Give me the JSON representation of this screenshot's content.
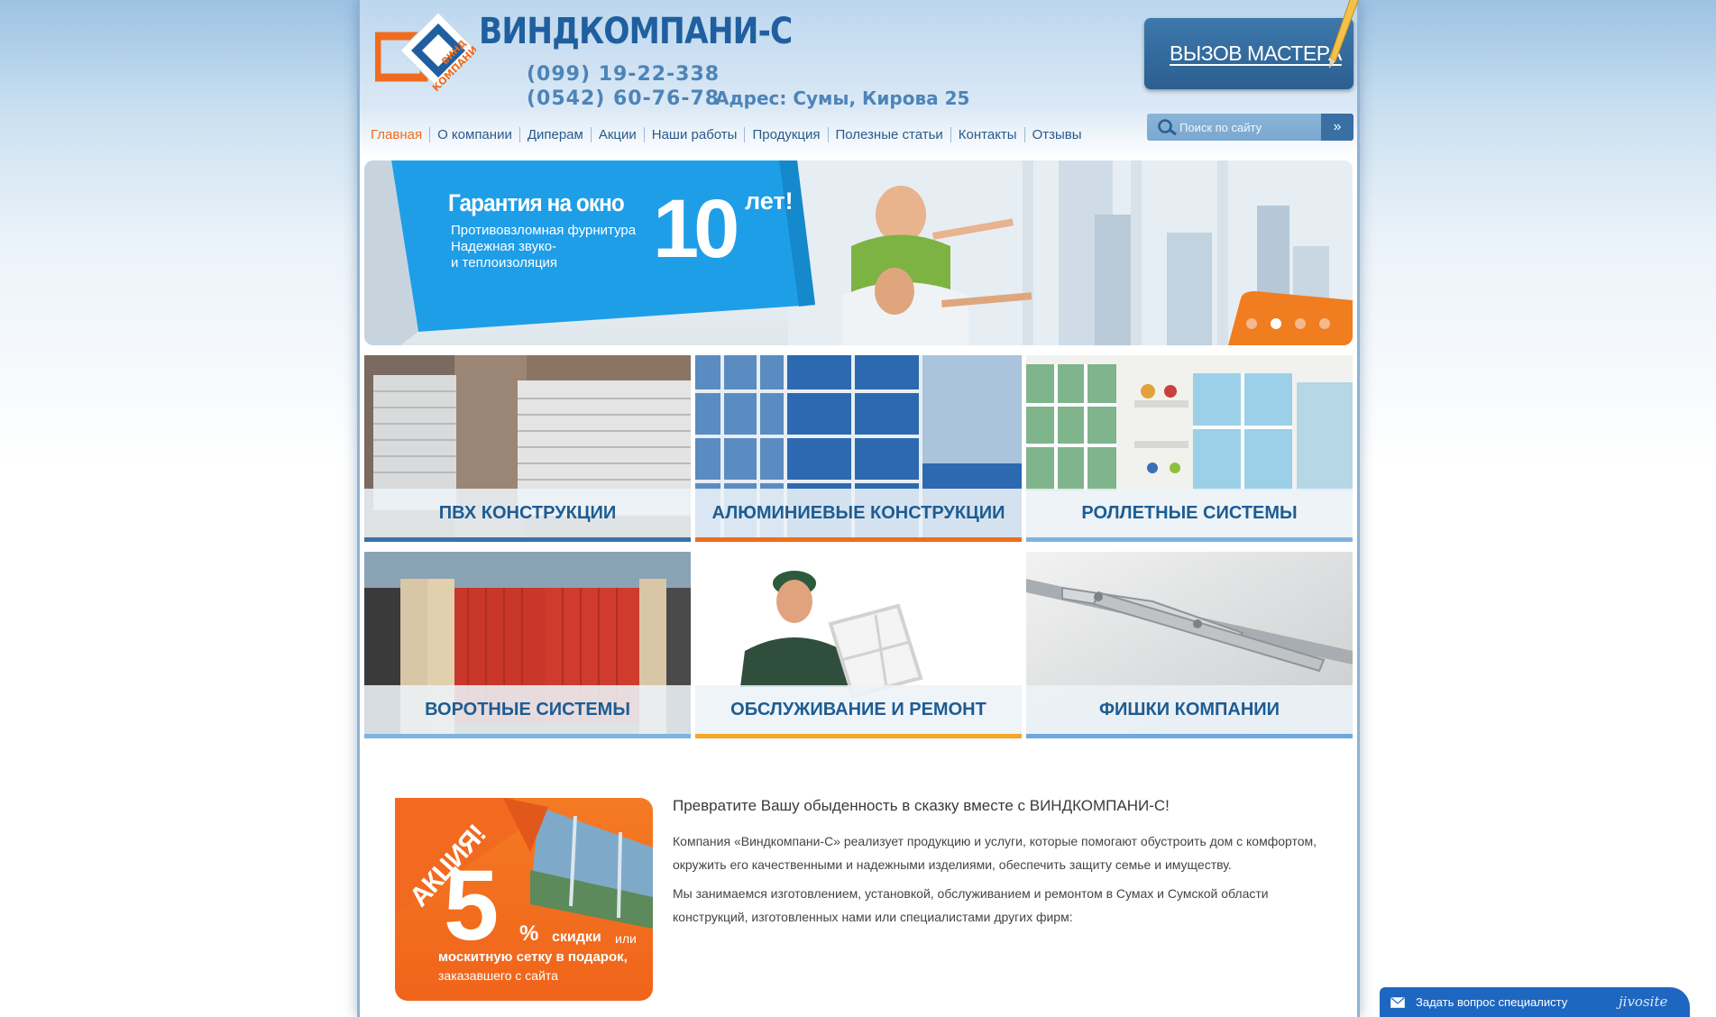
{
  "header": {
    "brand": "ВИНДКОМПАНИ-С",
    "logo_text_top": "ВИНД",
    "logo_text_bottom": "КОМПАНИ",
    "phone1": "(099) 19-22-338",
    "phone2": "(0542) 60-76-78",
    "address": "Адрес: Сумы, Кирова 25",
    "call_button": "ВЫЗОВ МАСТЕРА",
    "search_placeholder": "Поиск по сайту",
    "search_go": "»"
  },
  "nav": [
    {
      "label": "Главная",
      "active": true
    },
    {
      "label": "О компании"
    },
    {
      "label": "Диперам"
    },
    {
      "label": "Акции"
    },
    {
      "label": "Наши работы"
    },
    {
      "label": "Продукция"
    },
    {
      "label": "Полезные статьи"
    },
    {
      "label": "Контакты"
    },
    {
      "label": "Отзывы"
    }
  ],
  "banner": {
    "title": "Гарантия на окно",
    "big_number": "10",
    "suffix": "лет!",
    "lines": [
      "Противовзломная фурнитура",
      "Надежная звуко-",
      "и теплоизоляция"
    ],
    "slides_count": 4,
    "active_slide": 2
  },
  "tiles": [
    {
      "label": "ПВХ КОНСТРУКЦИИ",
      "bar_color": "#3a73a8"
    },
    {
      "label": "АЛЮМИНИЕВЫЕ КОНСТРУКЦИИ",
      "bar_color": "#ef6c1e"
    },
    {
      "label": "РОЛЛЕТНЫЕ СИСТЕМЫ",
      "bar_color": "#7fb3e0"
    },
    {
      "label": "ВОРОТНЫЕ СИСТЕМЫ",
      "bar_color": "#7fb3e0"
    },
    {
      "label": "ОБСЛУЖИВАНИЕ И РЕМОНТ",
      "bar_color": "#f5a623"
    },
    {
      "label": "ФИШКИ КОМПАНИИ",
      "bar_color": "#6ea8de"
    }
  ],
  "promo": {
    "badge": "АКЦИЯ!",
    "number": "5",
    "percent": "%",
    "line1_bold": "скидки",
    "line1_rest": "или",
    "line2": "москитную сетку в подарок,",
    "line3": "заказавшего с сайта"
  },
  "intro": {
    "title": "Превратите Вашу обыденность в сказку вместе с ВИНДКОМПАНИ-С!",
    "p1": "Компания «Виндкомпани-С» реализует продукцию и услуги, которые помогают обустроить дом с комфортом, окружить его качественными и надежными изделиями, обеспечить защиту семье и имуществу.",
    "p2": "Мы занимаемся изготовлением, установкой, обслуживанием и ремонтом в Сумах и Сумской области конструкций, изготовленных нами или специалистами других фирм:"
  },
  "chat": {
    "label": "Задать вопрос специалисту",
    "brand": "jivosite"
  },
  "colors": {
    "brand_blue": "#1f5f9f",
    "accent_orange": "#ef6c1e",
    "banner_blue": "#1f9ee8"
  }
}
